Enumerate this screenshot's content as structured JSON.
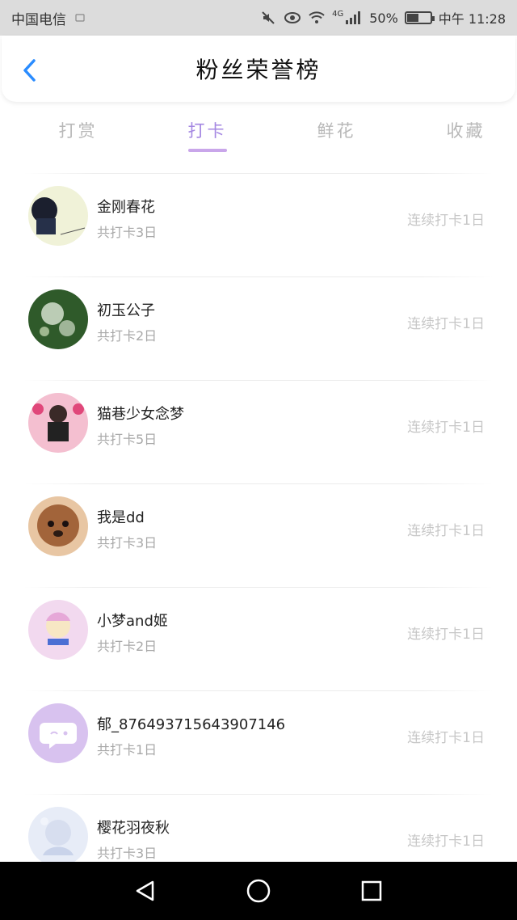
{
  "status_bar": {
    "carrier": "中国电信",
    "network": "4G",
    "battery": "50%",
    "battery_level": 0.5,
    "time": "中午 11:28"
  },
  "header": {
    "title": "粉丝荣誉榜",
    "back_icon": "chevron-left-icon",
    "accent": "#2a8cff"
  },
  "tabs": [
    {
      "label": "打赏",
      "active": false
    },
    {
      "label": "打卡",
      "active": true
    },
    {
      "label": "鲜花",
      "active": false
    },
    {
      "label": "收藏",
      "active": false
    }
  ],
  "active_color": "#a487e2",
  "items": [
    {
      "name": "金刚春花",
      "count": "共打卡3日",
      "streak": "连续打卡1日"
    },
    {
      "name": "初玉公子",
      "count": "共打卡2日",
      "streak": "连续打卡1日"
    },
    {
      "name": "猫巷少女念梦",
      "count": "共打卡5日",
      "streak": "连续打卡1日"
    },
    {
      "name": "我是dd",
      "count": "共打卡3日",
      "streak": "连续打卡1日"
    },
    {
      "name": "小梦and姬",
      "count": "共打卡2日",
      "streak": "连续打卡1日"
    },
    {
      "name": "郁_876493715643907146",
      "count": "共打卡1日",
      "streak": "连续打卡1日"
    },
    {
      "name": "樱花羽夜秋",
      "count": "共打卡3日",
      "streak": "连续打卡1日"
    }
  ],
  "navbar": {
    "back": "triangle-back-icon",
    "home": "circle-home-icon",
    "recents": "square-recents-icon"
  }
}
